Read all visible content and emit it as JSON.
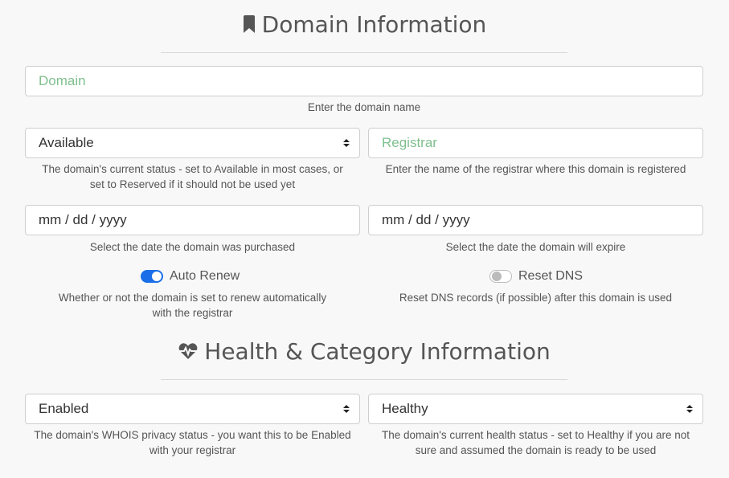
{
  "domain_section": {
    "title": "Domain Information",
    "icon": "bookmark-icon"
  },
  "domain_field": {
    "placeholder": "Domain",
    "help": "Enter the domain name"
  },
  "status_select": {
    "value": "Available",
    "help_line1": "The domain's current status - set to Available in most cases, or",
    "help_line2": "set to Reserved if it should not be used yet"
  },
  "registrar_field": {
    "placeholder": "Registrar",
    "help": "Enter the name of the registrar where this domain is registered"
  },
  "purchase_date": {
    "value": "mm / dd / yyyy",
    "help": "Select the date the domain was purchased"
  },
  "expire_date": {
    "value": "mm / dd / yyyy",
    "help": "Select the date the domain will expire"
  },
  "auto_renew": {
    "label": "Auto Renew",
    "checked": true,
    "help_line1": "Whether or not the domain is set to renew automatically",
    "help_line2": "with the registrar"
  },
  "reset_dns": {
    "label": "Reset DNS",
    "checked": false,
    "help": "Reset DNS records (if possible) after this domain is used"
  },
  "health_section": {
    "title": "Health & Category Information",
    "icon": "heartbeat-icon"
  },
  "whois_select": {
    "value": "Enabled",
    "help_line1": "The domain's WHOIS privacy status - you want this to be Enabled",
    "help_line2": "with your registrar"
  },
  "health_select": {
    "value": "Healthy",
    "help_line1": "The domain's current health status - set to Healthy if you are not",
    "help_line2": "sure and assumed the domain is ready to be used"
  },
  "colors": {
    "accent": "#1a6fe8",
    "placeholder": "#7fbf8e",
    "background": "#f8f8f8"
  }
}
